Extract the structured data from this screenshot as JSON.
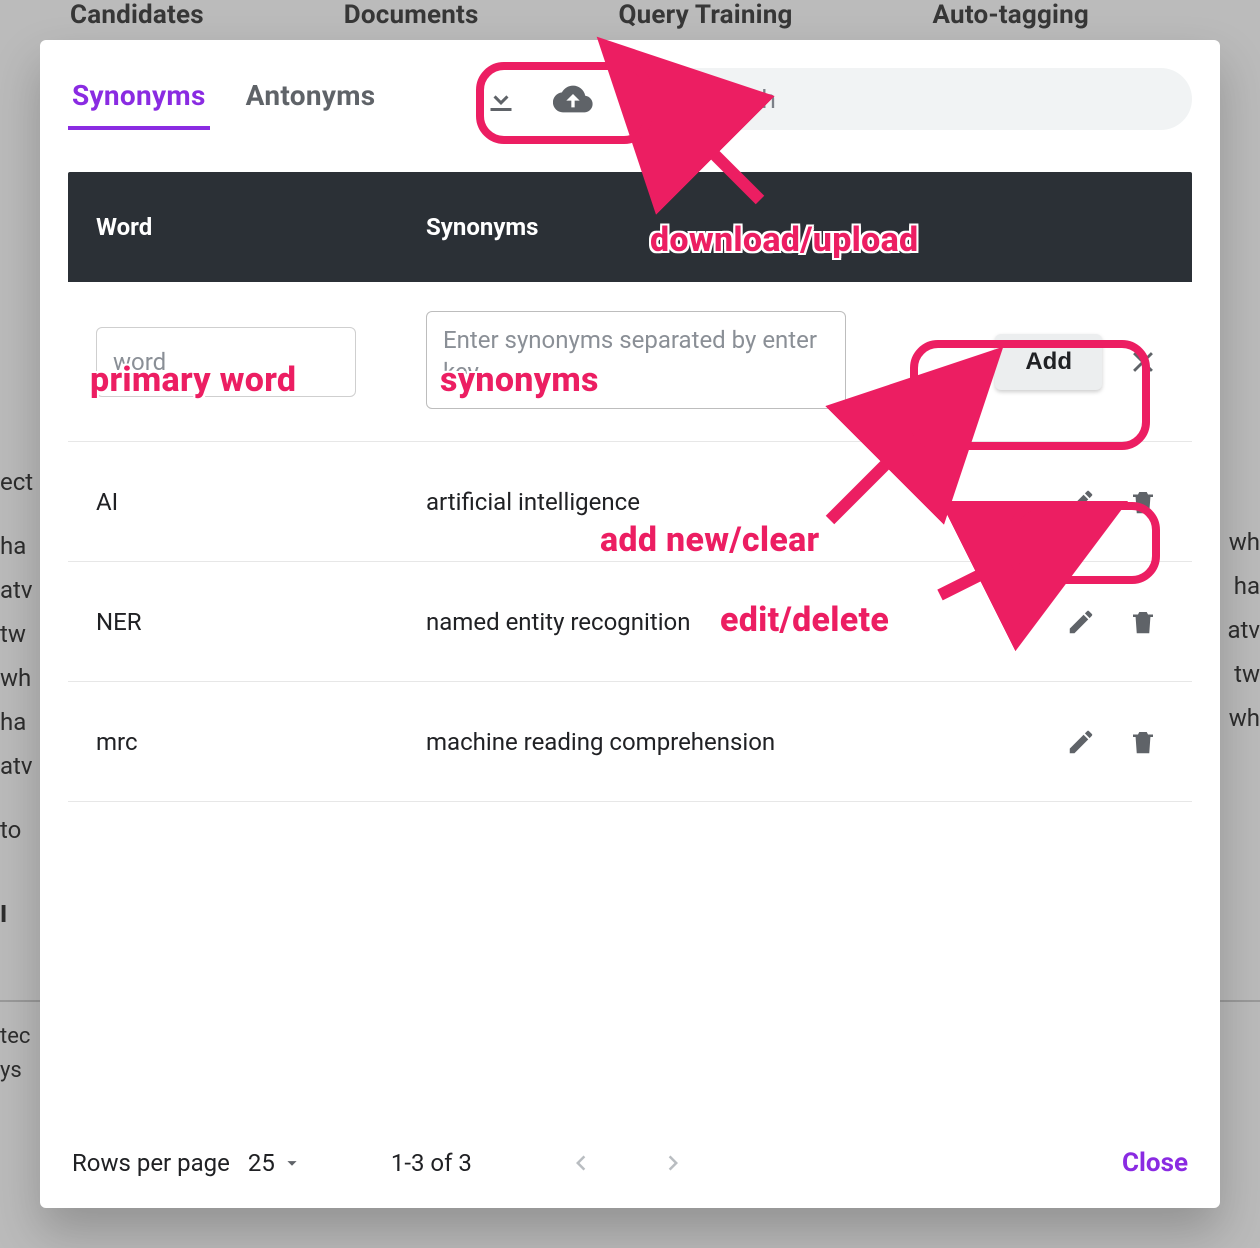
{
  "background": {
    "tabs": [
      "Candidates",
      "Documents",
      "Query Training",
      "Auto-tagging"
    ],
    "body_fragments": [
      "ect",
      "ha",
      "atv",
      "tw",
      "wh",
      "ha",
      "atv",
      "to",
      "I"
    ],
    "body_fragments_right": [
      "wh",
      "ha",
      "atv",
      "tw",
      "wh"
    ],
    "footer_fragments": [
      "tec",
      "ys"
    ]
  },
  "modal": {
    "tabs": {
      "synonyms": "Synonyms",
      "antonyms": "Antonyms",
      "active": "synonyms"
    },
    "search": {
      "placeholder": "Search",
      "value": ""
    },
    "columns": {
      "word": "Word",
      "synonyms": "Synonyms"
    },
    "new_row": {
      "word_placeholder": "word",
      "synonyms_placeholder": "Enter synonyms separated by enter key",
      "add_label": "Add"
    },
    "rows": [
      {
        "word": "AI",
        "synonyms": "artificial intelligence"
      },
      {
        "word": "NER",
        "synonyms": "named entity recognition"
      },
      {
        "word": "mrc",
        "synonyms": "machine reading comprehension"
      }
    ],
    "footer": {
      "rows_per_page_label": "Rows per page",
      "rows_per_page_value": "25",
      "range": "1-3 of 3",
      "close": "Close"
    }
  },
  "annotations": {
    "download_upload": "download/upload",
    "primary_word": "primary word",
    "synonyms": "synonyms",
    "add_new_clear": "add new/clear",
    "edit_delete": "edit/delete"
  }
}
